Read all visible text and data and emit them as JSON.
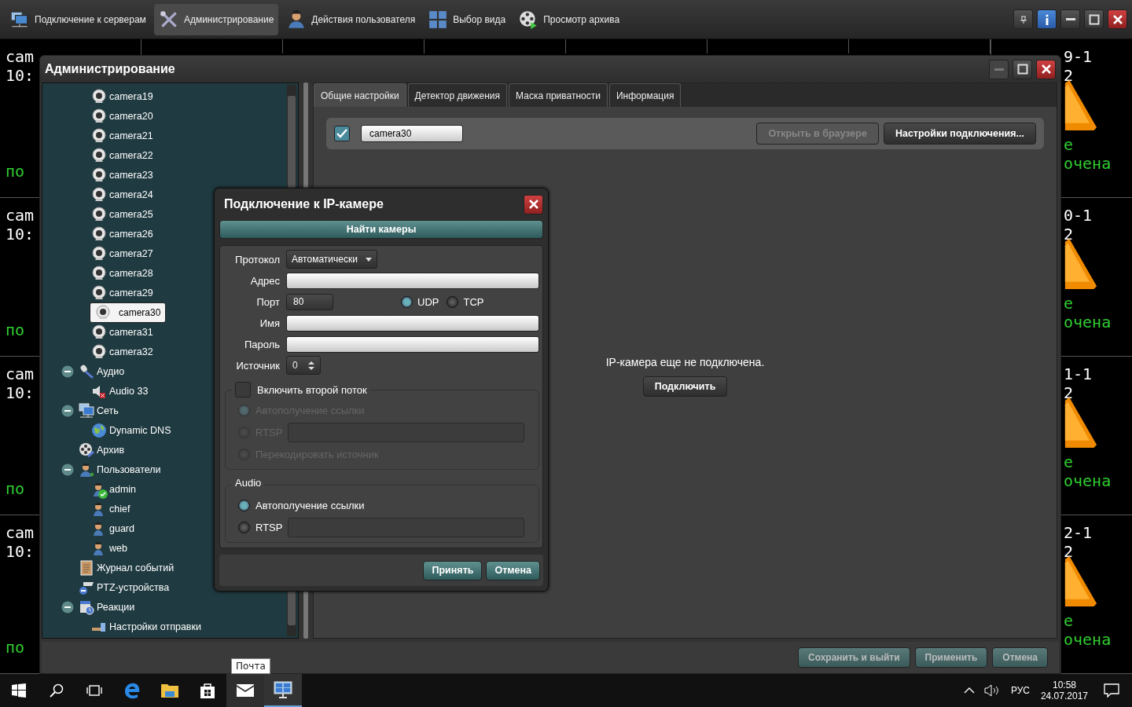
{
  "toolbar": {
    "items": [
      {
        "label": "Подключение к серверам",
        "kind": "servers",
        "selected": false
      },
      {
        "label": "Администрирование",
        "kind": "tools",
        "selected": true
      },
      {
        "label": "Действия пользователя",
        "kind": "user",
        "selected": false
      },
      {
        "label": "Выбор вида",
        "kind": "layout",
        "selected": false
      },
      {
        "label": "Просмотр архива",
        "kind": "archive",
        "selected": false
      }
    ]
  },
  "video_tiles": {
    "left": [
      {
        "name": "cam",
        "time": "10:",
        "status": "по"
      },
      {
        "name": "cam",
        "time": "10:",
        "status": "по"
      },
      {
        "name": "cam",
        "time": "10:",
        "status": "по"
      },
      {
        "name": "cam",
        "time": "10:",
        "status": "по"
      }
    ],
    "right": [
      {
        "name": "9-1",
        "time": "2",
        "status_1": "е",
        "status_2": "очена"
      },
      {
        "name": "0-1",
        "time": "2",
        "status_1": "е",
        "status_2": "очена"
      },
      {
        "name": "1-1",
        "time": "2",
        "status_1": "е",
        "status_2": "очена"
      },
      {
        "name": "2-1",
        "time": "2",
        "status_1": "е",
        "status_2": "очена"
      }
    ]
  },
  "admin_window": {
    "title": "Администрирование",
    "tree": {
      "scrolled_group_tail": [
        {
          "label": "camera19",
          "kind": "camera",
          "selected": false
        },
        {
          "label": "camera20",
          "kind": "camera",
          "selected": false
        },
        {
          "label": "camera21",
          "kind": "camera",
          "selected": false
        },
        {
          "label": "camera22",
          "kind": "camera",
          "selected": false
        },
        {
          "label": "camera23",
          "kind": "camera",
          "selected": false
        },
        {
          "label": "camera24",
          "kind": "camera",
          "selected": false
        },
        {
          "label": "camera25",
          "kind": "camera",
          "selected": false
        },
        {
          "label": "camera26",
          "kind": "camera",
          "selected": false
        },
        {
          "label": "camera27",
          "kind": "camera",
          "selected": false
        },
        {
          "label": "camera28",
          "kind": "camera",
          "selected": false
        },
        {
          "label": "camera29",
          "kind": "camera",
          "selected": false
        },
        {
          "label": "camera30",
          "kind": "camera",
          "selected": true
        },
        {
          "label": "camera31",
          "kind": "camera",
          "selected": false
        },
        {
          "label": "camera32",
          "kind": "camera",
          "selected": false
        }
      ],
      "items": [
        {
          "label": "Аудио",
          "kind": "microphone",
          "selected": false,
          "expanded": true,
          "children": [
            {
              "label": "Audio 33",
              "kind": "speaker",
              "selected": false
            }
          ]
        },
        {
          "label": "Сеть",
          "kind": "network",
          "selected": false,
          "expanded": true,
          "children": [
            {
              "label": "Dynamic DNS",
              "kind": "globe",
              "selected": false
            }
          ]
        },
        {
          "label": "Архив",
          "kind": "archive",
          "selected": false
        },
        {
          "label": "Пользователи",
          "kind": "users",
          "selected": false,
          "expanded": true,
          "children": [
            {
              "label": "admin",
              "kind": "user",
              "selected": false,
              "online": true
            },
            {
              "label": "chief",
              "kind": "user",
              "selected": false,
              "online": false
            },
            {
              "label": "guard",
              "kind": "user",
              "selected": false,
              "online": false
            },
            {
              "label": "web",
              "kind": "user",
              "selected": false,
              "online": false
            }
          ]
        },
        {
          "label": "Журнал событий",
          "kind": "journal",
          "selected": false
        },
        {
          "label": "PTZ-устройства",
          "kind": "ptz",
          "selected": false
        },
        {
          "label": "Реакции",
          "kind": "reactions",
          "selected": false,
          "expanded": true,
          "children": [
            {
              "label": "Настройки отправки",
              "kind": "send",
              "selected": false
            }
          ]
        }
      ]
    },
    "tabs": [
      {
        "label": "Общие настройки",
        "selected": true
      },
      {
        "label": "Детектор движения",
        "selected": false
      },
      {
        "label": "Маска приватности",
        "selected": false
      },
      {
        "label": "Информация",
        "selected": false
      }
    ],
    "camera": {
      "enabled": true,
      "name": "camera30"
    },
    "buttons": [
      {
        "label": "Открыть в браузере",
        "disabled": true
      },
      {
        "label": "Настройки подключения...",
        "disabled": false
      }
    ],
    "message": "IP-камера еще не подключена.",
    "connect_button": "Подключить",
    "footer_buttons": [
      "Сохранить и выйти",
      "Применить",
      "Отмена"
    ]
  },
  "dialog": {
    "title": "Подключение к IP-камере",
    "find_button": "Найти камеры",
    "protocol": {
      "label": "Протокол",
      "value": "Автоматически"
    },
    "address": {
      "label": "Адрес"
    },
    "port": {
      "label": "Порт",
      "value": "80"
    },
    "transport": [
      {
        "label": "UDP",
        "selected": true
      },
      {
        "label": "TCP",
        "selected": false
      }
    ],
    "name": {
      "label": "Имя"
    },
    "password": {
      "label": "Пароль"
    },
    "source": {
      "label": "Источник",
      "value": "0"
    },
    "second_stream": {
      "label": "Включить второй поток",
      "checked": false,
      "options": [
        {
          "label": "Автополучение ссылки",
          "selected": true,
          "disabled": true
        },
        {
          "label": "RTSP",
          "selected": false,
          "disabled": true,
          "field": true
        },
        {
          "label": "Перекодировать источник",
          "selected": false,
          "disabled": true
        }
      ]
    },
    "audio": {
      "title": "Audio",
      "options": [
        {
          "label": "Автополучение ссылки",
          "selected": true,
          "disabled": false
        },
        {
          "label": "RTSP",
          "selected": false,
          "disabled": false,
          "field": true
        }
      ]
    },
    "ok": "Принять",
    "cancel": "Отмена"
  },
  "taskbar": {
    "tooltip": "Почта",
    "language": "РУС",
    "time": "10:58",
    "date": "24.07.2017"
  }
}
